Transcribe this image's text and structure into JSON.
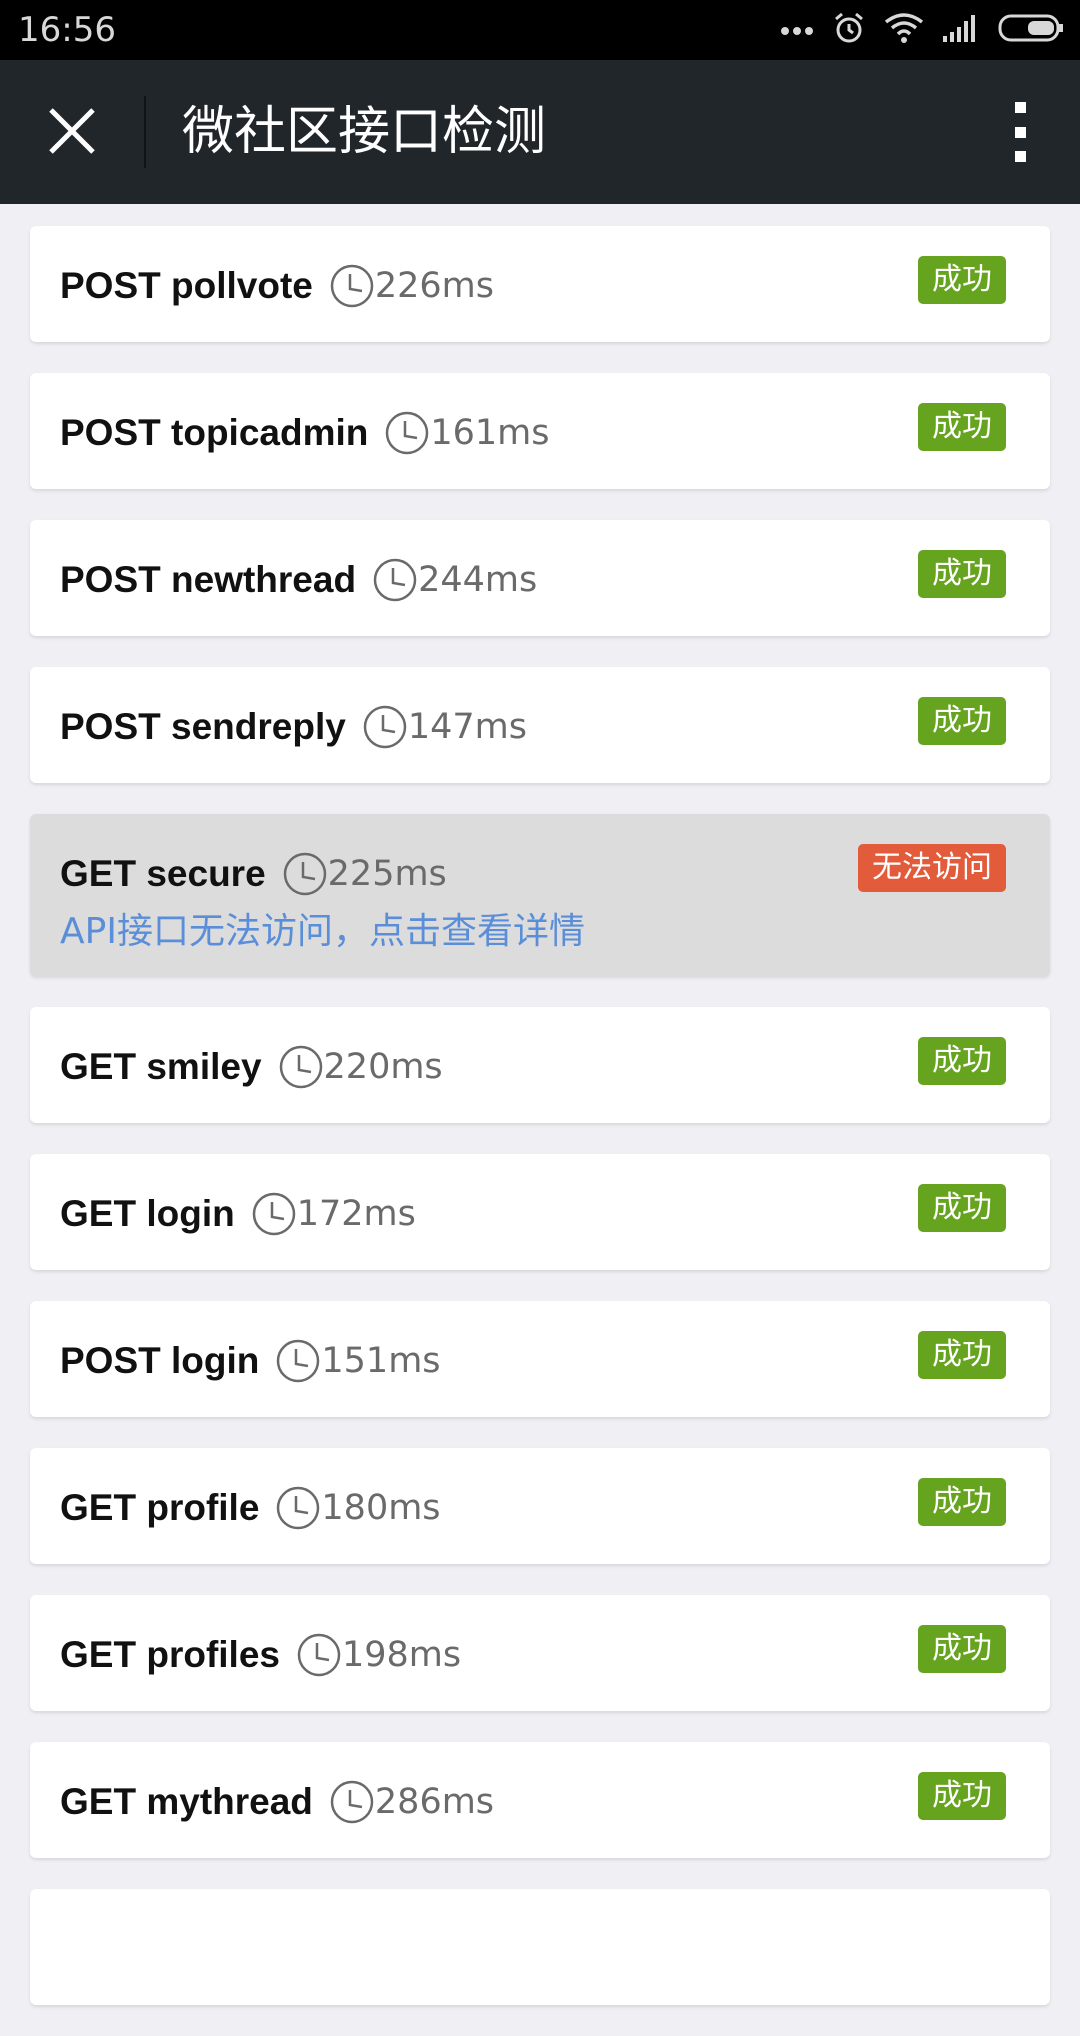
{
  "status_bar": {
    "time": "16:56"
  },
  "header": {
    "title": "微社区接口检测"
  },
  "items": [
    {
      "name": "POST pollvote",
      "time": "226ms",
      "status": "成功",
      "state": "ok"
    },
    {
      "name": "POST topicadmin",
      "time": "161ms",
      "status": "成功",
      "state": "ok"
    },
    {
      "name": "POST newthread",
      "time": "244ms",
      "status": "成功",
      "state": "ok"
    },
    {
      "name": "POST sendreply",
      "time": "147ms",
      "status": "成功",
      "state": "ok"
    },
    {
      "name": "GET secure",
      "time": "225ms",
      "status": "无法访问",
      "state": "bad",
      "detail": "API接口无法访问，点击查看详情"
    },
    {
      "name": "GET smiley",
      "time": "220ms",
      "status": "成功",
      "state": "ok"
    },
    {
      "name": "GET login",
      "time": "172ms",
      "status": "成功",
      "state": "ok"
    },
    {
      "name": "POST login",
      "time": "151ms",
      "status": "成功",
      "state": "ok"
    },
    {
      "name": "GET profile",
      "time": "180ms",
      "status": "成功",
      "state": "ok"
    },
    {
      "name": "GET profiles",
      "time": "198ms",
      "status": "成功",
      "state": "ok"
    },
    {
      "name": "GET mythread",
      "time": "286ms",
      "status": "成功",
      "state": "ok"
    }
  ],
  "colors": {
    "header_bg": "#21262b",
    "success": "#66a31e",
    "failure": "#e25b3a",
    "link": "#5b8ed8"
  },
  "icons": [
    "close-icon",
    "more-vertical-icon",
    "clock-icon",
    "signal-dots-icon",
    "alarm-icon",
    "wifi-icon",
    "cell-signal-icon",
    "battery-icon"
  ]
}
